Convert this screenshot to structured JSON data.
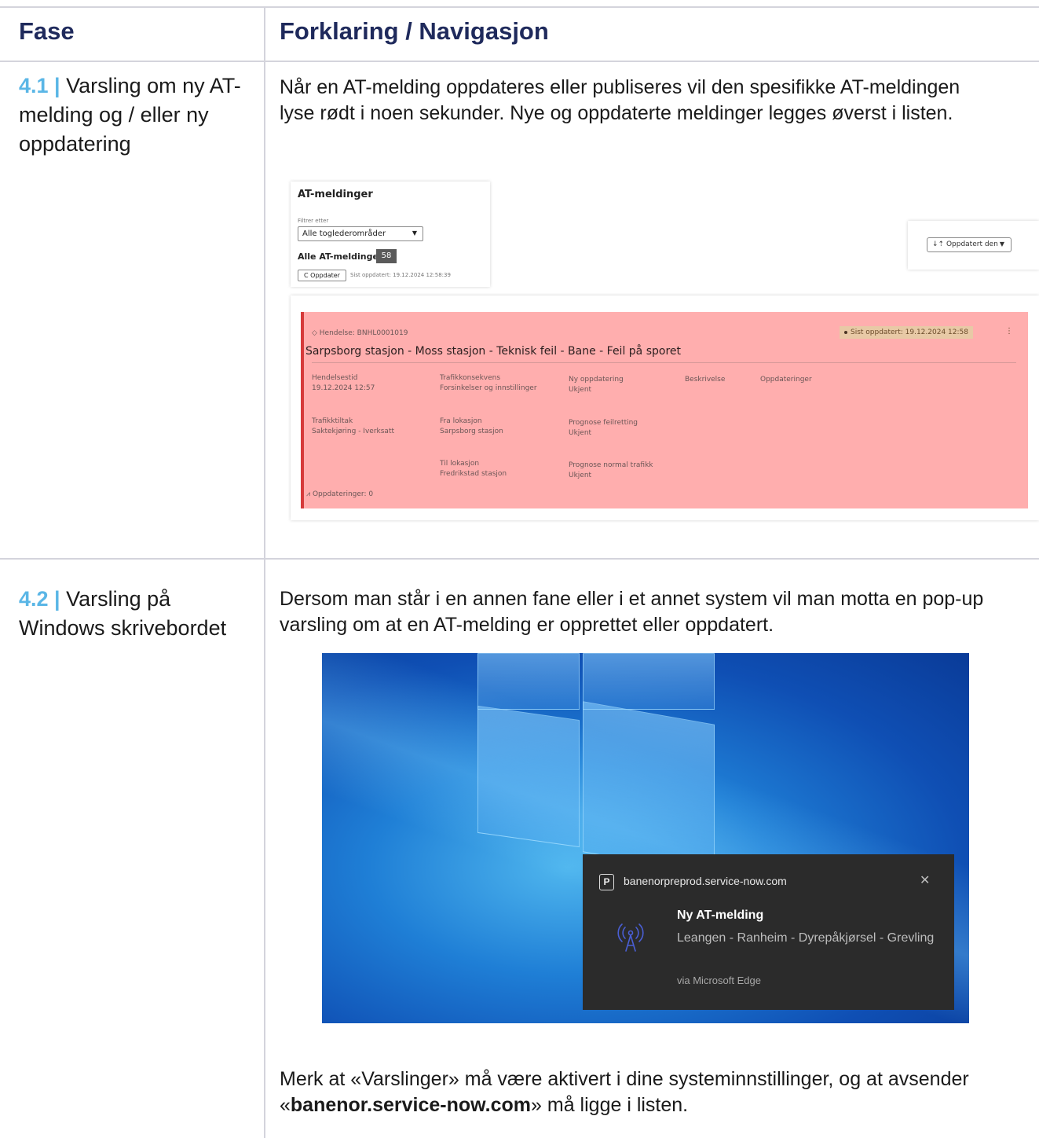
{
  "header": {
    "col1": "Fase",
    "col2": "Forklaring / Navigasjon"
  },
  "rows": [
    {
      "num": "4.1 |",
      "fase": "Varsling om ny AT-melding og / eller ny oppdatering",
      "text": "Når en AT-melding oppdateres eller publiseres vil den spesifikke AT-meldingen lyse rødt i noen sekunder. Nye og oppdaterte meldinger legges øverst i listen."
    },
    {
      "num": "4.2 |",
      "fase": "Varsling på Windows skrivebordet",
      "text": "Dersom man står i en annen fane eller i et annet system vil man motta en pop-up varsling om at en AT-melding er opprettet eller oppdatert.",
      "note_before": "Merk at «Varslinger» må være aktivert i dine systeminnstillinger, og at avsender «",
      "note_bold": "banenor.service-now.com",
      "note_after": "» må ligge i listen."
    }
  ],
  "at_screen": {
    "title": "AT-meldinger",
    "filter_label": "Filtrer etter",
    "filter_value": "Alle toglederområder",
    "all_label": "Alle AT-meldinger:",
    "all_count": "58",
    "refresh_button": "C Oppdater",
    "last_updated": "Sist oppdatert: 19.12.2024 12:58:39",
    "sort_label": "↓⇡ Oppdatert den",
    "card": {
      "event": "◇ Hendelse: BNHL0001019",
      "status_chip": "Sist oppdatert: 19.12.2024 12:58",
      "title": "Sarpsborg stasjon - Moss stasjon - Teknisk feil - Bane - Feil på sporet",
      "fields": [
        {
          "label": "Hendelsestid",
          "value": "19.12.2024 12:57"
        },
        {
          "label": "Trafikkonsekvens",
          "value": "Forsinkelser og innstillinger"
        },
        {
          "label": "Ny oppdatering",
          "value": "Ukjent"
        },
        {
          "label": "Beskrivelse",
          "value": ""
        },
        {
          "label": "Oppdateringer",
          "value": ""
        },
        {
          "label": "Trafikktiltak",
          "value": "Saktekjøring - Iverksatt"
        },
        {
          "label": "Fra lokasjon",
          "value": "Sarpsborg stasjon"
        },
        {
          "label": "Prognose feilretting",
          "value": "Ukjent"
        },
        {
          "label": "Til lokasjon",
          "value": "Fredrikstad stasjon"
        },
        {
          "label": "Prognose normal trafikk",
          "value": "Ukjent"
        }
      ],
      "updates_count": "Oppdateringer: 0"
    }
  },
  "toast": {
    "source": "banenorpreprod.service-now.com",
    "title": "Ny AT-melding",
    "body": "Leangen - Ranheim - Dyrepåkjørsel - Grevling",
    "via": "via Microsoft Edge",
    "logo_letter": "P",
    "close_icon": "close-icon",
    "app_icon": "radio-tower-icon"
  }
}
